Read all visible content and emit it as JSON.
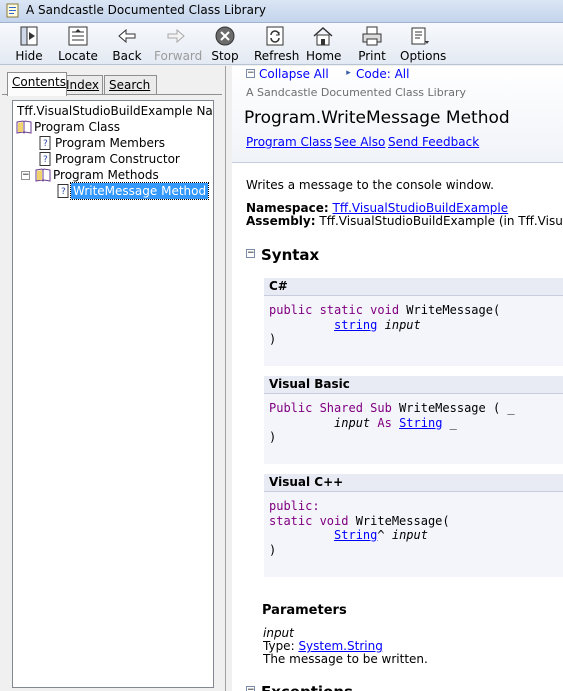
{
  "window": {
    "title": "A Sandcastle Documented Class Library"
  },
  "toolbar": {
    "hide": "Hide",
    "locate": "Locate",
    "back": "Back",
    "forward": "Forward",
    "stop": "Stop",
    "refresh": "Refresh",
    "home": "Home",
    "print": "Print",
    "options": "Options"
  },
  "tabs": {
    "contents": "Contents",
    "index": "Index",
    "search": "Search"
  },
  "tree": {
    "namespace": "Tff.VisualStudioBuildExample Namespace",
    "program_class": "Program Class",
    "program_members": "Program Members",
    "program_constructor": "Program Constructor",
    "program_methods": "Program Methods",
    "writemessage_method": "WriteMessage Method"
  },
  "header": {
    "collapse_all": "Collapse All",
    "code_all": "Code: All",
    "library_title": "A Sandcastle Documented Class Library",
    "page_title": "Program.WriteMessage Method",
    "link_program_class": "Program Class",
    "link_see_also": "See Also",
    "link_send_feedback": "Send Feedback"
  },
  "summary": "Writes a message to the console window.",
  "namespace_label": "Namespace:",
  "namespace_value": "Tff.VisualStudioBuildExample",
  "assembly_label": "Assembly:",
  "assembly_value": "Tff.VisualStudioBuildExample (in Tff.VisualS",
  "syntax": {
    "heading": "Syntax",
    "csharp": {
      "label": "C#",
      "l1_kw": "public static void",
      "l1_rest": " WriteMessage(",
      "l2_type": "string",
      "l2_param": "input",
      "l3": ")"
    },
    "vb": {
      "label": "Visual Basic",
      "l1_kw": "Public Shared Sub",
      "l1_rest": " WriteMessage ( _",
      "l2_param": "input",
      "l2_as": "As",
      "l2_type": "String",
      "l2_tail": "_",
      "l3": ")"
    },
    "cpp": {
      "label": "Visual C++",
      "l1": "public:",
      "l2_kw": "static void",
      "l2_rest": " WriteMessage(",
      "l3_type": "String",
      "l3_hat": "^",
      "l3_param": "input",
      "l4": ")"
    }
  },
  "parameters": {
    "heading": "Parameters",
    "name": "input",
    "type_label": "Type:",
    "type_value": "System.String",
    "description": "The message to be written."
  },
  "exceptions_heading": "Exceptions"
}
